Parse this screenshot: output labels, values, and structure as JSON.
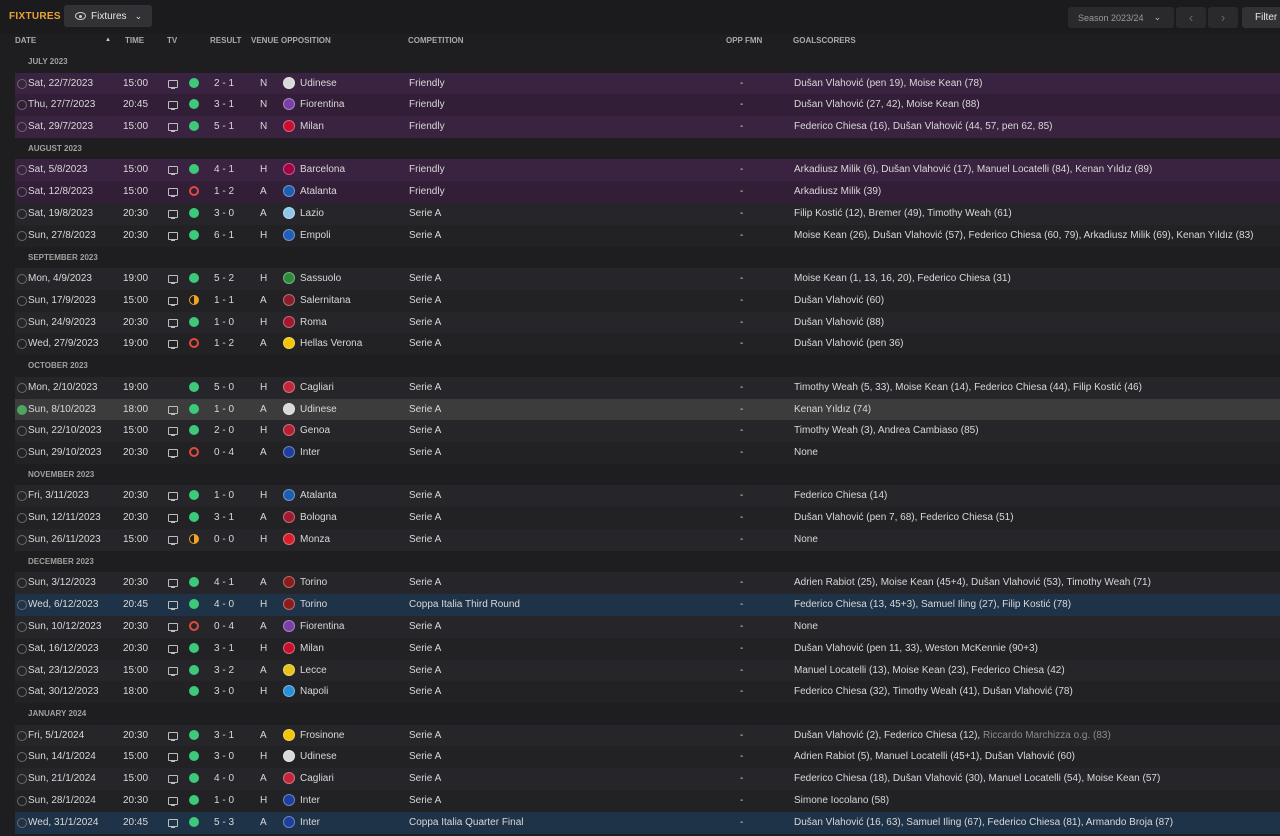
{
  "header": {
    "title": "FIXTURES",
    "view_label": "Fixtures",
    "season_label": "Season 2023/24",
    "filter_label": "Filter"
  },
  "columns": {
    "date": "DATE",
    "time": "TIME",
    "tv": "TV",
    "result": "RESULT",
    "venue": "VENUE",
    "opposition": "OPPOSITION",
    "competition": "COMPETITION",
    "opp_fmn": "OPP FMN",
    "goalscorers": "GOALSCORERS"
  },
  "colors": {
    "accent": "#e8a33a",
    "win": "#3ec87a",
    "loss": "#e14a3d",
    "draw": "#f0a424",
    "friendly_row": "#3a2340",
    "cup_row": "#1f3348"
  },
  "months": [
    {
      "label": "JULY 2023",
      "fixtures": [
        {
          "date": "Sat, 22/7/2023",
          "time": "15:00",
          "tv": true,
          "result": "W",
          "score": "2 - 1",
          "venue": "N",
          "opp": "Udinese",
          "crest": "#d9d9d9",
          "comp": "Friendly",
          "type": "friendly",
          "fmn": "-",
          "goals": "Dušan Vlahović (pen 19), Moise Kean (78)"
        },
        {
          "date": "Thu, 27/7/2023",
          "time": "20:45",
          "tv": true,
          "result": "W",
          "score": "3 - 1",
          "venue": "N",
          "opp": "Fiorentina",
          "crest": "#7b3fa8",
          "comp": "Friendly",
          "type": "friendly",
          "fmn": "-",
          "goals": "Dušan Vlahović (27, 42), Moise Kean (88)"
        },
        {
          "date": "Sat, 29/7/2023",
          "time": "15:00",
          "tv": true,
          "result": "W",
          "score": "5 - 1",
          "venue": "N",
          "opp": "Milan",
          "crest": "#c8102e",
          "comp": "Friendly",
          "type": "friendly",
          "fmn": "-",
          "goals": "Federico Chiesa (16), Dušan Vlahović (44, 57, pen 62, 85)"
        }
      ]
    },
    {
      "label": "AUGUST 2023",
      "fixtures": [
        {
          "date": "Sat, 5/8/2023",
          "time": "15:00",
          "tv": true,
          "result": "W",
          "score": "4 - 1",
          "venue": "H",
          "opp": "Barcelona",
          "crest": "#a50044",
          "comp": "Friendly",
          "type": "friendly",
          "fmn": "-",
          "goals": "Arkadiusz Milik (6), Dušan Vlahović (17), Manuel Locatelli (84), Kenan Yıldız (89)"
        },
        {
          "date": "Sat, 12/8/2023",
          "time": "15:00",
          "tv": true,
          "result": "L",
          "score": "1 - 2",
          "venue": "A",
          "opp": "Atalanta",
          "crest": "#1e5eb0",
          "comp": "Friendly",
          "type": "friendly",
          "fmn": "-",
          "goals": "Arkadiusz Milik (39)"
        },
        {
          "date": "Sat, 19/8/2023",
          "time": "20:30",
          "tv": true,
          "result": "W",
          "score": "3 - 0",
          "venue": "A",
          "opp": "Lazio",
          "crest": "#8ec6e8",
          "comp": "Serie A",
          "type": "league",
          "fmn": "-",
          "goals": "Filip Kostić (12), Bremer (49), Timothy Weah (61)"
        },
        {
          "date": "Sun, 27/8/2023",
          "time": "20:30",
          "tv": true,
          "result": "W",
          "score": "6 - 1",
          "venue": "H",
          "opp": "Empoli",
          "crest": "#1f5fb5",
          "comp": "Serie A",
          "type": "league",
          "fmn": "-",
          "goals": "Moise Kean (26), Dušan Vlahović (57), Federico Chiesa (60, 79), Arkadiusz Milik (69), Kenan Yıldız (83)"
        }
      ]
    },
    {
      "label": "SEPTEMBER 2023",
      "fixtures": [
        {
          "date": "Mon, 4/9/2023",
          "time": "19:00",
          "tv": true,
          "result": "W",
          "score": "5 - 2",
          "venue": "H",
          "opp": "Sassuolo",
          "crest": "#2e8b3c",
          "comp": "Serie A",
          "type": "league",
          "fmn": "-",
          "goals": "Moise Kean (1, 13, 16, 20), Federico Chiesa (31)"
        },
        {
          "date": "Sun, 17/9/2023",
          "time": "15:00",
          "tv": true,
          "result": "D",
          "score": "1 - 1",
          "venue": "A",
          "opp": "Salernitana",
          "crest": "#8b1e2b",
          "comp": "Serie A",
          "type": "league",
          "fmn": "-",
          "goals": "Dušan Vlahović (60)"
        },
        {
          "date": "Sun, 24/9/2023",
          "time": "20:30",
          "tv": true,
          "result": "W",
          "score": "1 - 0",
          "venue": "H",
          "opp": "Roma",
          "crest": "#a3172f",
          "comp": "Serie A",
          "type": "league",
          "fmn": "-",
          "goals": "Dušan Vlahović (88)"
        },
        {
          "date": "Wed, 27/9/2023",
          "time": "19:00",
          "tv": true,
          "result": "L",
          "score": "1 - 2",
          "venue": "A",
          "opp": "Hellas Verona",
          "crest": "#f2c500",
          "comp": "Serie A",
          "type": "league",
          "fmn": "-",
          "goals": "Dušan Vlahović (pen 36)"
        }
      ]
    },
    {
      "label": "OCTOBER 2023",
      "fixtures": [
        {
          "date": "Mon, 2/10/2023",
          "time": "19:00",
          "tv": false,
          "result": "W",
          "score": "5 - 0",
          "venue": "H",
          "opp": "Cagliari",
          "crest": "#c2263a",
          "comp": "Serie A",
          "type": "league",
          "fmn": "-",
          "goals": "Timothy Weah (5, 33), Moise Kean (14), Federico Chiesa (44), Filip Kostić (46)"
        },
        {
          "date": "Sun, 8/10/2023",
          "time": "18:00",
          "tv": true,
          "result": "W",
          "score": "1 - 0",
          "venue": "A",
          "opp": "Udinese",
          "crest": "#d9d9d9",
          "comp": "Serie A",
          "type": "selected",
          "fmn": "-",
          "goals": "Kenan Yıldız (74)",
          "done": true
        },
        {
          "date": "Sun, 22/10/2023",
          "time": "15:00",
          "tv": true,
          "result": "W",
          "score": "2 - 0",
          "venue": "H",
          "opp": "Genoa",
          "crest": "#b32034",
          "comp": "Serie A",
          "type": "league",
          "fmn": "-",
          "goals": "Timothy Weah (3), Andrea Cambiaso (85)"
        },
        {
          "date": "Sun, 29/10/2023",
          "time": "20:30",
          "tv": true,
          "result": "L",
          "score": "0 - 4",
          "venue": "A",
          "opp": "Inter",
          "crest": "#1e3f9e",
          "comp": "Serie A",
          "type": "league",
          "fmn": "-",
          "goals": "None"
        }
      ]
    },
    {
      "label": "NOVEMBER 2023",
      "fixtures": [
        {
          "date": "Fri, 3/11/2023",
          "time": "20:30",
          "tv": true,
          "result": "W",
          "score": "1 - 0",
          "venue": "H",
          "opp": "Atalanta",
          "crest": "#1e5eb0",
          "comp": "Serie A",
          "type": "league",
          "fmn": "-",
          "goals": "Federico Chiesa (14)"
        },
        {
          "date": "Sun, 12/11/2023",
          "time": "20:30",
          "tv": true,
          "result": "W",
          "score": "3 - 1",
          "venue": "A",
          "opp": "Bologna",
          "crest": "#9e1b32",
          "comp": "Serie A",
          "type": "league",
          "fmn": "-",
          "goals": "Dušan Vlahović (pen 7, 68), Federico Chiesa (51)"
        },
        {
          "date": "Sun, 26/11/2023",
          "time": "15:00",
          "tv": true,
          "result": "D",
          "score": "0 - 0",
          "venue": "H",
          "opp": "Monza",
          "crest": "#d71f2b",
          "comp": "Serie A",
          "type": "league",
          "fmn": "-",
          "goals": "None"
        }
      ]
    },
    {
      "label": "DECEMBER 2023",
      "fixtures": [
        {
          "date": "Sun, 3/12/2023",
          "time": "20:30",
          "tv": true,
          "result": "W",
          "score": "4 - 1",
          "venue": "A",
          "opp": "Torino",
          "crest": "#8a1c1c",
          "comp": "Serie A",
          "type": "league",
          "fmn": "-",
          "goals": "Adrien Rabiot (25), Moise Kean (45+4), Dušan Vlahović (53), Timothy Weah (71)"
        },
        {
          "date": "Wed, 6/12/2023",
          "time": "20:45",
          "tv": true,
          "result": "W",
          "score": "4 - 0",
          "venue": "H",
          "opp": "Torino",
          "crest": "#8a1c1c",
          "comp": "Coppa Italia Third Round",
          "type": "cup",
          "fmn": "-",
          "goals": "Federico Chiesa (13, 45+3), Samuel Iling (27), Filip Kostić (78)"
        },
        {
          "date": "Sun, 10/12/2023",
          "time": "20:30",
          "tv": true,
          "result": "L",
          "score": "0 - 4",
          "venue": "A",
          "opp": "Fiorentina",
          "crest": "#7b3fa8",
          "comp": "Serie A",
          "type": "league",
          "fmn": "-",
          "goals": "None"
        },
        {
          "date": "Sat, 16/12/2023",
          "time": "20:30",
          "tv": true,
          "result": "W",
          "score": "3 - 1",
          "venue": "H",
          "opp": "Milan",
          "crest": "#c8102e",
          "comp": "Serie A",
          "type": "league",
          "fmn": "-",
          "goals": "Dušan Vlahović (pen 11, 33), Weston McKennie (90+3)"
        },
        {
          "date": "Sat, 23/12/2023",
          "time": "15:00",
          "tv": true,
          "result": "W",
          "score": "3 - 2",
          "venue": "A",
          "opp": "Lecce",
          "crest": "#e6c21a",
          "comp": "Serie A",
          "type": "league",
          "fmn": "-",
          "goals": "Manuel Locatelli (13), Moise Kean (23), Federico Chiesa (42)"
        },
        {
          "date": "Sat, 30/12/2023",
          "time": "18:00",
          "tv": false,
          "result": "W",
          "score": "3 - 0",
          "venue": "H",
          "opp": "Napoli",
          "crest": "#2a8fd6",
          "comp": "Serie A",
          "type": "league",
          "fmn": "-",
          "goals": "Federico Chiesa (32), Timothy Weah (41), Dušan Vlahović (78)"
        }
      ]
    },
    {
      "label": "JANUARY 2024",
      "fixtures": [
        {
          "date": "Fri, 5/1/2024",
          "time": "20:30",
          "tv": true,
          "result": "W",
          "score": "3 - 1",
          "venue": "A",
          "opp": "Frosinone",
          "crest": "#f2c500",
          "comp": "Serie A",
          "type": "league",
          "fmn": "-",
          "goals": "Dušan Vlahović (2), Federico Chiesa (12), ",
          "goals_extra": "Riccardo Marchizza o.g. (83)"
        },
        {
          "date": "Sun, 14/1/2024",
          "time": "15:00",
          "tv": true,
          "result": "W",
          "score": "3 - 0",
          "venue": "H",
          "opp": "Udinese",
          "crest": "#d9d9d9",
          "comp": "Serie A",
          "type": "league",
          "fmn": "-",
          "goals": "Adrien Rabiot (5), Manuel Locatelli (45+1), Dušan Vlahović (60)"
        },
        {
          "date": "Sun, 21/1/2024",
          "time": "15:00",
          "tv": true,
          "result": "W",
          "score": "4 - 0",
          "venue": "A",
          "opp": "Cagliari",
          "crest": "#c2263a",
          "comp": "Serie A",
          "type": "league",
          "fmn": "-",
          "goals": "Federico Chiesa (18), Dušan Vlahović (30), Manuel Locatelli (54), Moise Kean (57)"
        },
        {
          "date": "Sun, 28/1/2024",
          "time": "20:30",
          "tv": true,
          "result": "W",
          "score": "1 - 0",
          "venue": "H",
          "opp": "Inter",
          "crest": "#1e3f9e",
          "comp": "Serie A",
          "type": "league",
          "fmn": "-",
          "goals": "Simone Iocolano (58)"
        },
        {
          "date": "Wed, 31/1/2024",
          "time": "20:45",
          "tv": true,
          "result": "W",
          "score": "5 - 3",
          "venue": "A",
          "opp": "Inter",
          "crest": "#1e3f9e",
          "comp": "Coppa Italia Quarter Final",
          "type": "cup",
          "fmn": "-",
          "goals": "Dušan Vlahović (16, 63), Samuel Iling (67), Federico Chiesa (81), Armando Broja (87)"
        }
      ]
    }
  ]
}
